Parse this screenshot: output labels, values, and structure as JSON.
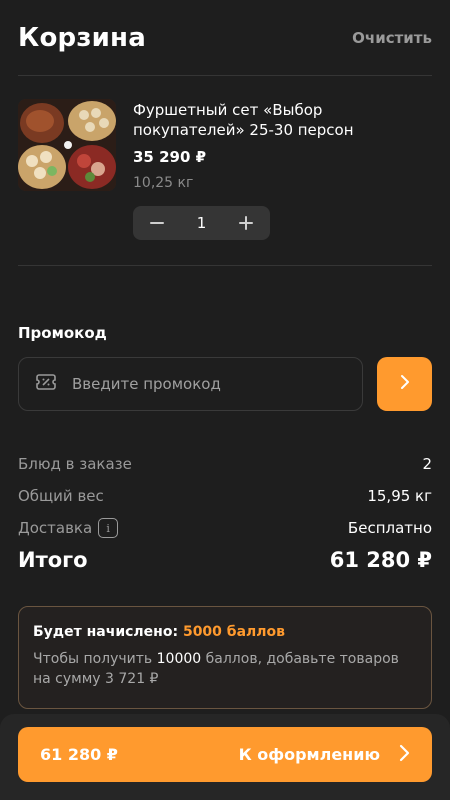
{
  "header": {
    "title": "Корзина",
    "clear_label": "Очистить"
  },
  "cart_item": {
    "name": "Фуршетный сет «Выбор покупателей» 25-30 персон",
    "price": "35 290 ₽",
    "weight": "10,25 кг",
    "quantity": "1",
    "image_icon": "food-platter-image",
    "minus_icon": "minus-icon",
    "plus_icon": "plus-icon"
  },
  "promo": {
    "label": "Промокод",
    "placeholder": "Введите промокод",
    "value": "",
    "icon": "coupon-icon",
    "submit_icon": "chevron-right-icon"
  },
  "summary": {
    "dishes_label": "Блюд в заказе",
    "dishes_value": "2",
    "weight_label": "Общий вес",
    "weight_value": "15,95 кг",
    "delivery_label": "Доставка",
    "delivery_info": "i",
    "delivery_value": "Бесплатно",
    "total_label": "Итого",
    "total_value": "61 280 ₽"
  },
  "bonus": {
    "title": "Будет начислено: ",
    "points": "5000 баллов",
    "text_prefix": "Чтобы получить ",
    "text_points": "10000",
    "text_suffix": " баллов, добавьте товаров на сумму 3 721 ₽"
  },
  "checkout": {
    "amount": "61 280 ₽",
    "label": "К оформлению"
  },
  "colors": {
    "accent": "#ff9a2e",
    "background": "#1e1e1e",
    "muted": "#9a9a9a"
  }
}
